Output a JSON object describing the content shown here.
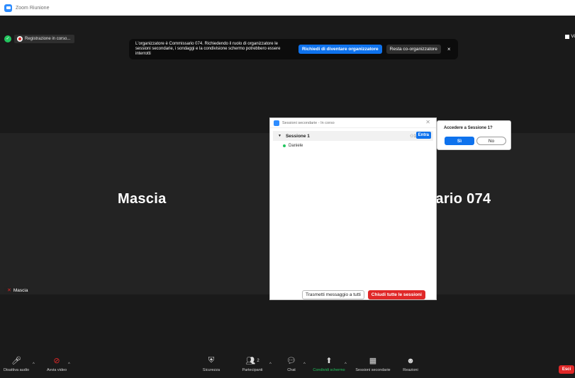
{
  "window": {
    "title": "Zoom Riunione"
  },
  "recording": {
    "label": "Registrazione in corso..."
  },
  "banner": {
    "message": "L'organizzatore è Commissario 074. Richiedendo il ruolo di organizzatore le sessioni secondarie, i sondaggi e la condivisione schermo potrebbero essere interrotti",
    "primary": "Richiedi di diventare organizzatore",
    "secondary": "Resta co-organizzatore",
    "close": "×"
  },
  "view_button": "Vi",
  "participants": {
    "left_name": "Mascia",
    "right_name": "sario 074",
    "nametag": "Mascia"
  },
  "breakout": {
    "title": "Sessioni secondarie - In corso",
    "session_name": "Sessione 1",
    "count": "1",
    "join_label": "Entra",
    "participant": "Daniele",
    "broadcast_label": "Trasmetti messaggio a tutti",
    "close_all_label": "Chiudi tutte le sessioni"
  },
  "popup": {
    "question": "Accedere a Sessione 1?",
    "yes": "Sì",
    "no": "No"
  },
  "toolbar": {
    "audio": "Disattiva audio",
    "video": "Avvia video",
    "security": "Sicurezza",
    "participants": "Partecipanti",
    "participants_count": "2",
    "chat": "Chat",
    "share": "Condividi schermo",
    "breakout": "Sessioni secondarie",
    "reactions": "Reazioni",
    "leave": "Esci"
  },
  "colors": {
    "accent": "#0e72ed",
    "danger": "#e02828",
    "share": "#22c55e"
  }
}
